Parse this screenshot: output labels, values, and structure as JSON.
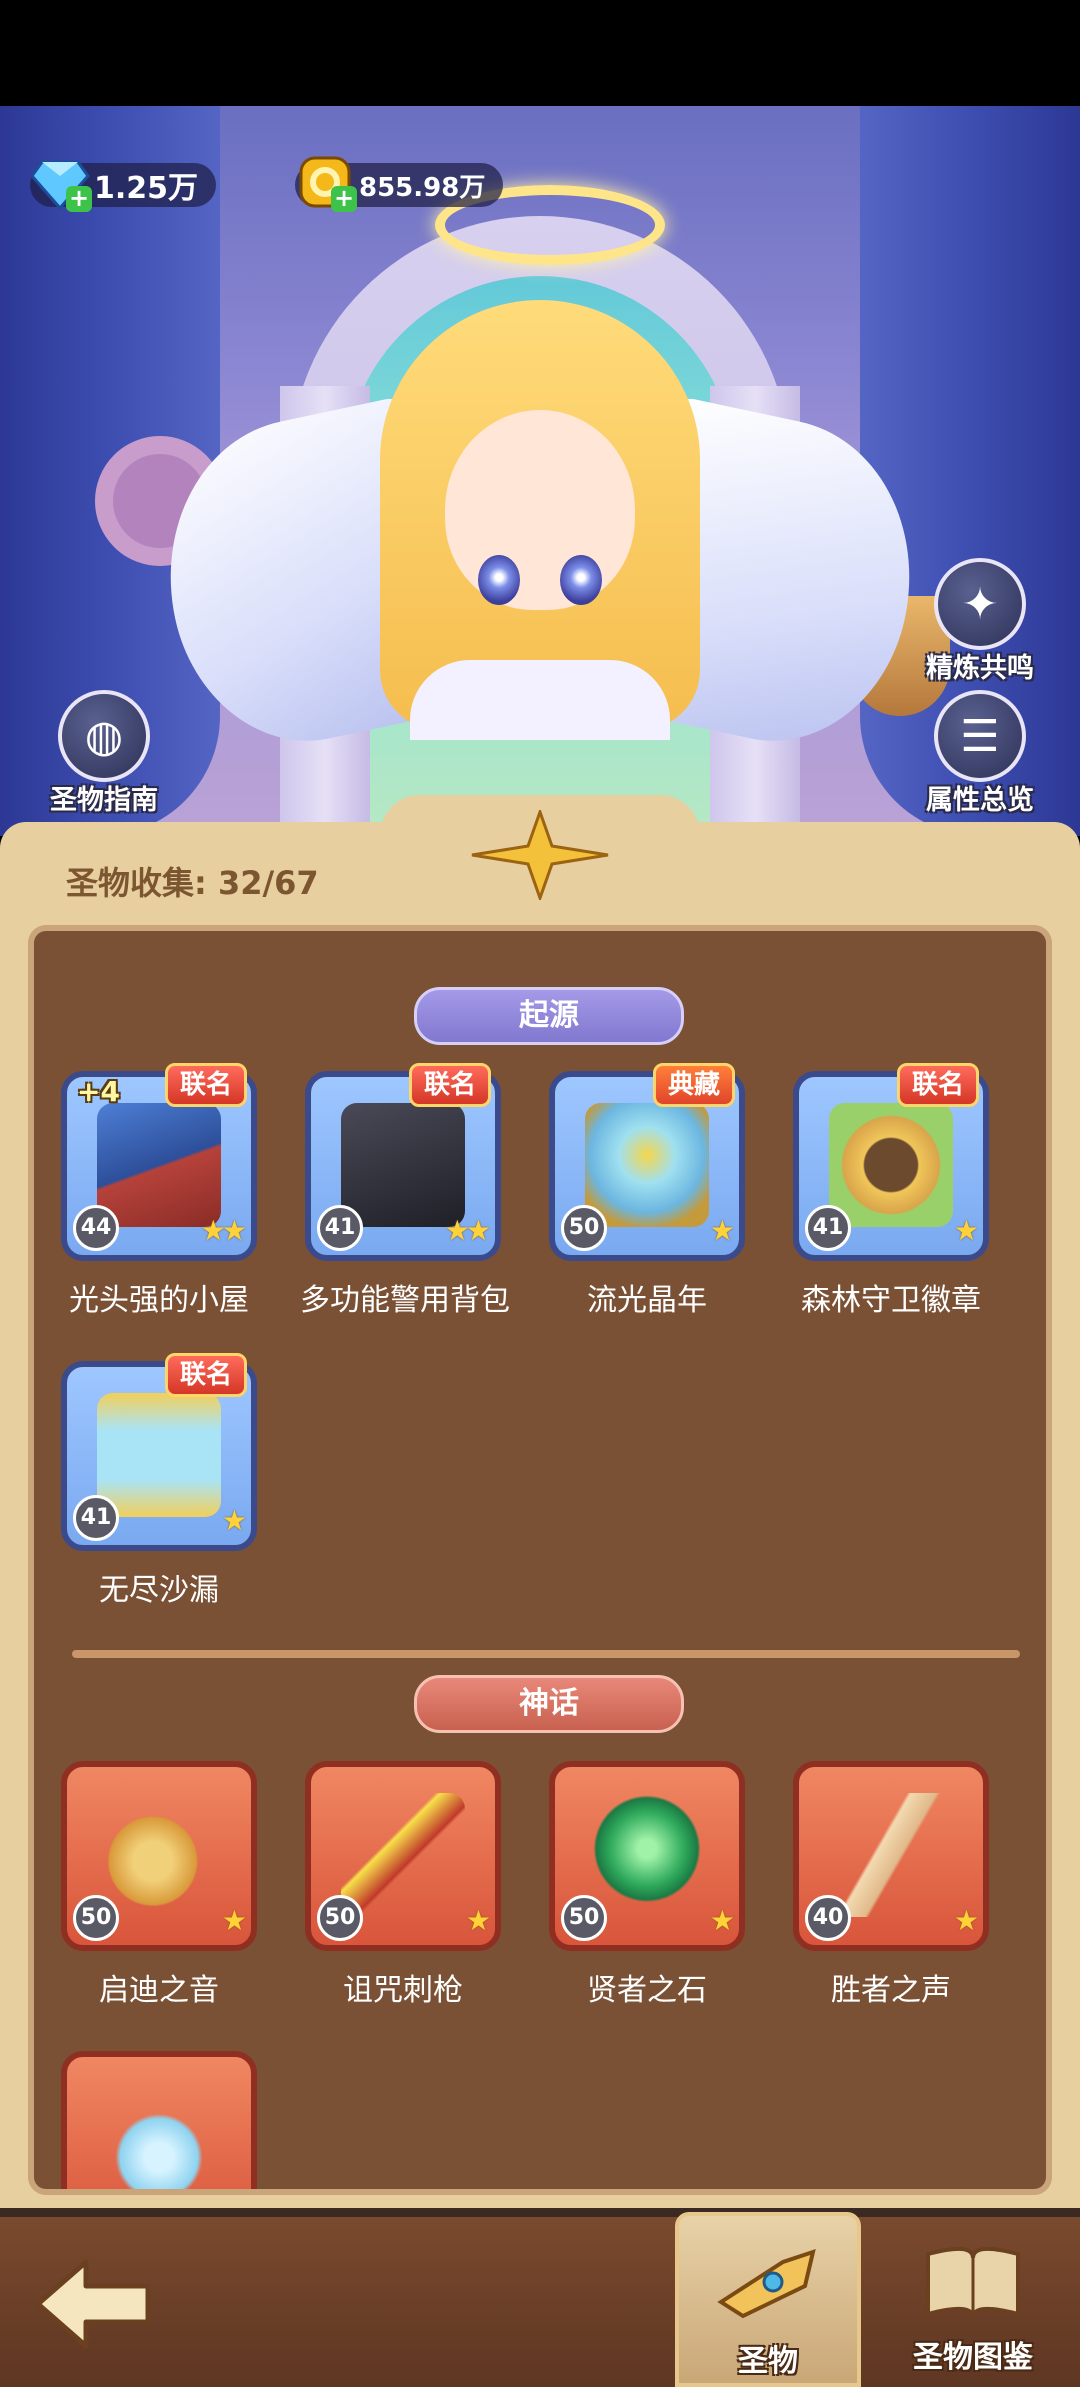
{
  "currency": {
    "gems": "1.25万",
    "coins": "855.98万"
  },
  "side_buttons": {
    "refine": "精炼共鸣",
    "guide": "圣物指南",
    "attributes": "属性总览"
  },
  "collection": {
    "label": "圣物收集: 32/67"
  },
  "sections": [
    {
      "title": "起源",
      "items": [
        {
          "name": "光头强的小屋",
          "badge": "联名",
          "level": "44",
          "stars": "★★",
          "extra": "+4",
          "art_color": "#3b6fc4"
        },
        {
          "name": "多功能警用背包",
          "badge": "联名",
          "level": "41",
          "stars": "★★",
          "art_color": "#2c2c36"
        },
        {
          "name": "流光晶年",
          "badge": "典藏",
          "level": "50",
          "stars": "★",
          "art_color": "#7fc7e8"
        },
        {
          "name": "森林守卫徽章",
          "badge": "联名",
          "level": "41",
          "stars": "★",
          "art_color": "#d9a54a"
        },
        {
          "name": "无尽沙漏",
          "badge": "联名",
          "level": "41",
          "stars": "★",
          "art_color": "#e0b64c"
        }
      ]
    },
    {
      "title": "神话",
      "items": [
        {
          "name": "启迪之音",
          "level": "50",
          "stars": "★",
          "art_color": "#e7b85a"
        },
        {
          "name": "诅咒刺枪",
          "level": "50",
          "stars": "★",
          "art_color": "#f2d23c"
        },
        {
          "name": "贤者之石",
          "level": "50",
          "stars": "★",
          "art_color": "#39b26a"
        },
        {
          "name": "胜者之声",
          "level": "40",
          "stars": "★",
          "art_color": "#c84030"
        },
        {
          "name": "",
          "level": "",
          "stars": "",
          "art_color": "#9fd9f2"
        }
      ]
    }
  ],
  "nav": {
    "tab_relic": "圣物",
    "tab_codex": "圣物图鉴"
  }
}
